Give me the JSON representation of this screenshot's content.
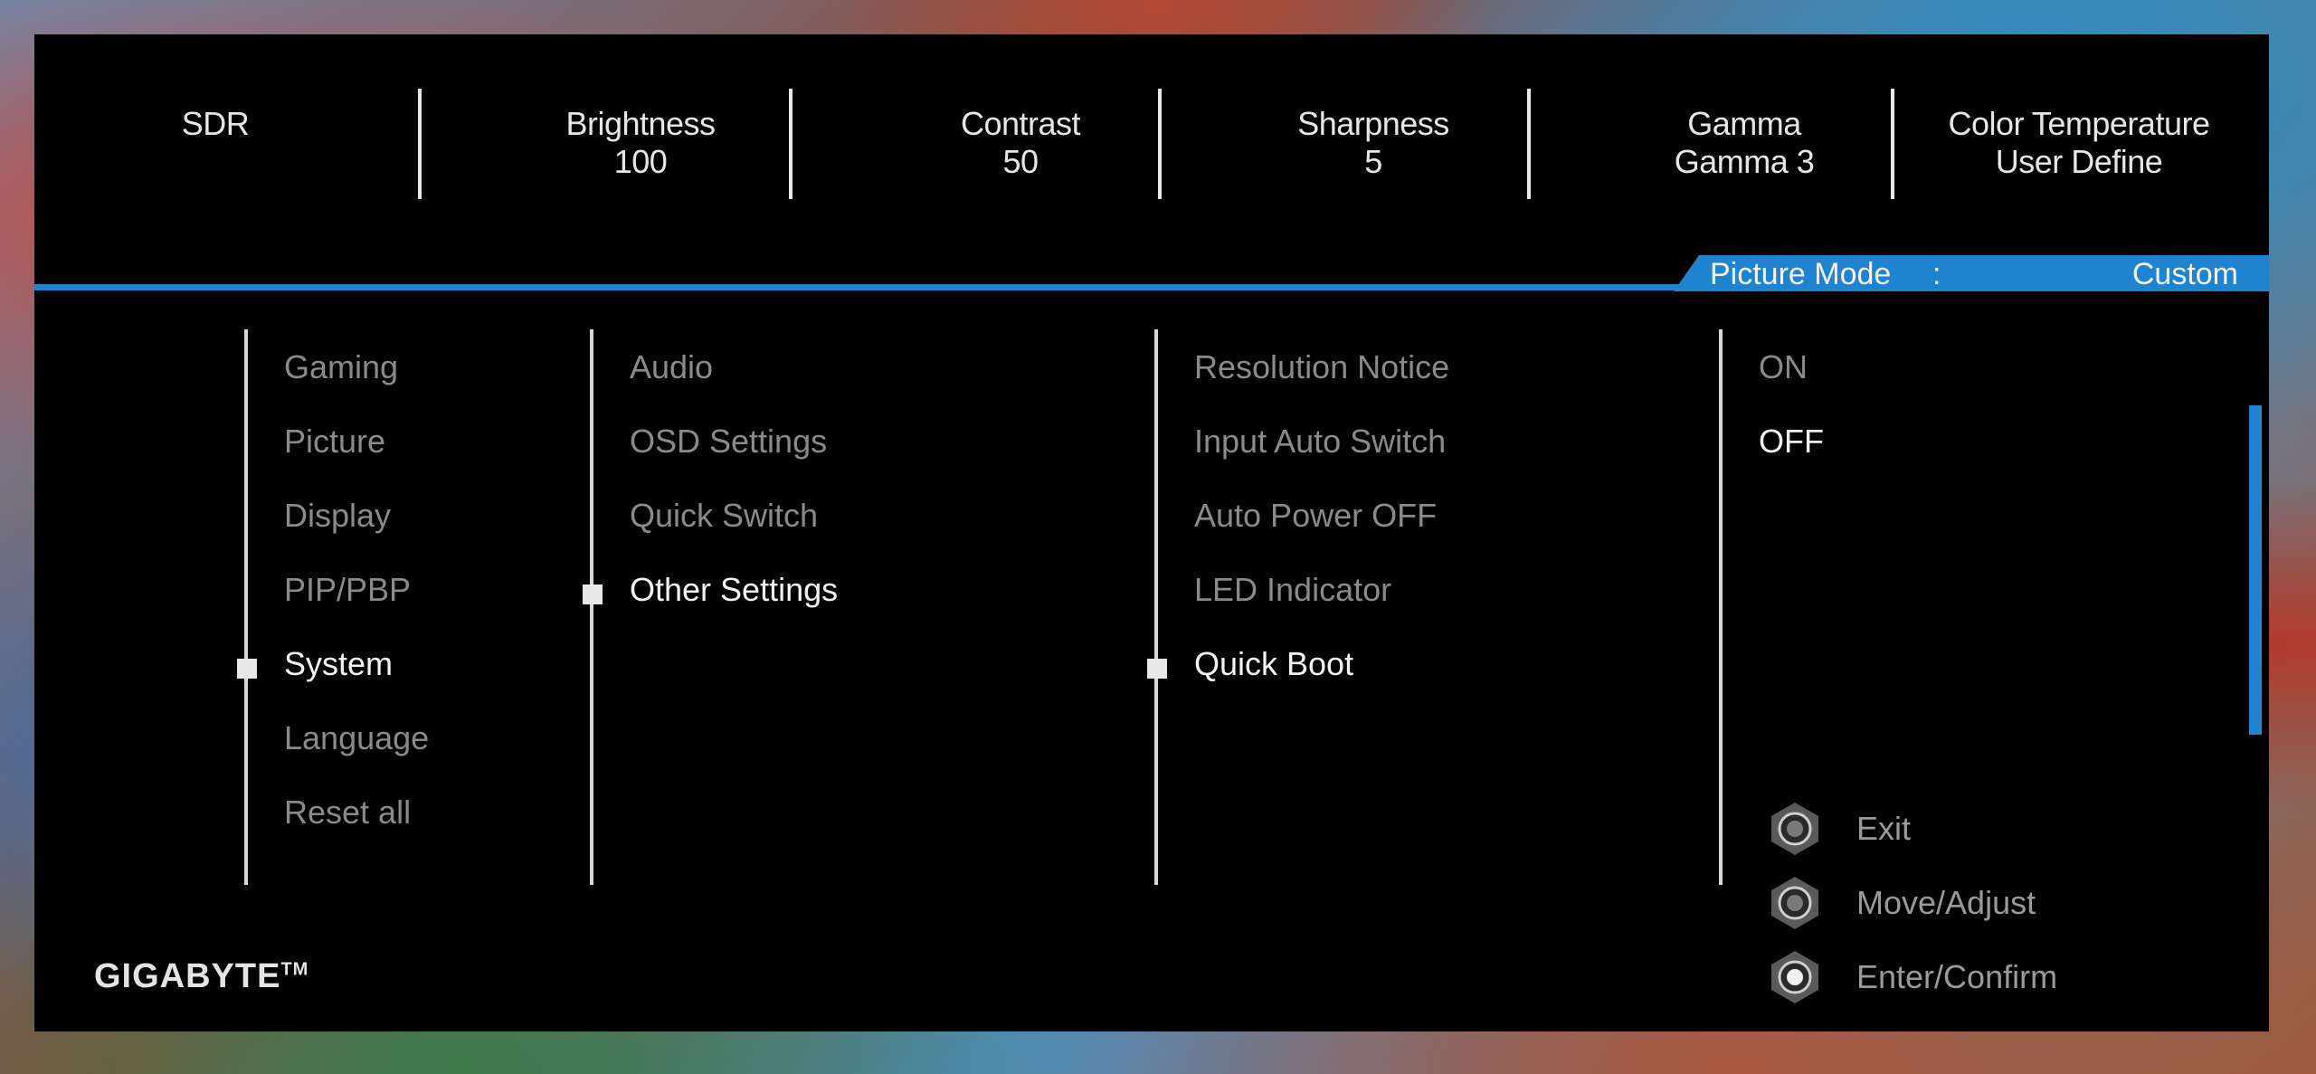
{
  "top_bar": {
    "mode": "SDR",
    "brightness": {
      "label": "Brightness",
      "value": "100"
    },
    "contrast": {
      "label": "Contrast",
      "value": "50"
    },
    "sharpness": {
      "label": "Sharpness",
      "value": "5"
    },
    "gamma": {
      "label": "Gamma",
      "value": "Gamma 3"
    },
    "color_temperature": {
      "label": "Color Temperature",
      "value": "User Define"
    }
  },
  "picture_mode": {
    "label": "Picture Mode",
    "separator": ":",
    "value": "Custom"
  },
  "menu": {
    "main": [
      "Gaming",
      "Picture",
      "Display",
      "PIP/PBP",
      "System",
      "Language",
      "Reset all"
    ],
    "main_selected": "System",
    "system": [
      "Audio",
      "OSD Settings",
      "Quick Switch",
      "Other Settings"
    ],
    "system_selected": "Other Settings",
    "other_settings": [
      "Resolution Notice",
      "Input Auto Switch",
      "Auto Power OFF",
      "LED Indicator",
      "Quick Boot"
    ],
    "other_selected": "Quick Boot",
    "quick_boot_options": [
      "ON",
      "OFF"
    ],
    "quick_boot_selected": "OFF"
  },
  "legend": [
    {
      "icon": "joystick-exit-icon",
      "label": "Exit"
    },
    {
      "icon": "joystick-move-icon",
      "label": "Move/Adjust"
    },
    {
      "icon": "joystick-enter-icon",
      "label": "Enter/Confirm"
    }
  ],
  "brand": {
    "name": "GIGABYTE",
    "trademark": "TM"
  },
  "colors": {
    "accent": "#1f83cf",
    "background": "#020202",
    "active_text": "#f4f4f4",
    "inactive_text": "#8a8a8a"
  }
}
